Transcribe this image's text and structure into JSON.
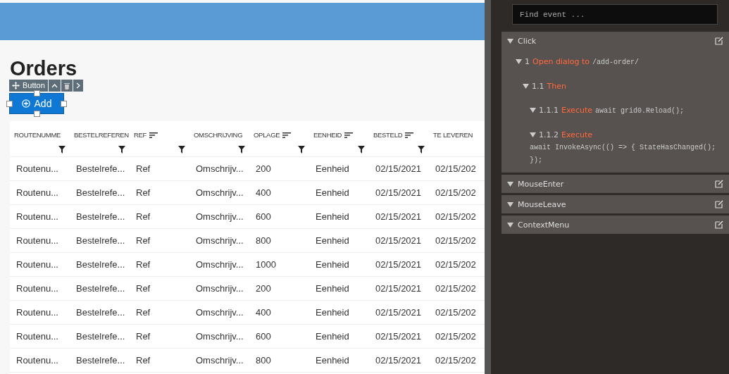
{
  "page": {
    "title": "Orders"
  },
  "designer_toolbar": {
    "label": "Button"
  },
  "add_button": {
    "label": "Add"
  },
  "grid": {
    "columns": [
      {
        "label": "ROUTENUMME",
        "sortable": false
      },
      {
        "label": "BESTELREFEREN",
        "sortable": false
      },
      {
        "label": "REF",
        "sortable": true
      },
      {
        "label": "OMSCHRIJVING",
        "sortable": false
      },
      {
        "label": "OPLAGE",
        "sortable": true
      },
      {
        "label": "EENHEID",
        "sortable": true
      },
      {
        "label": "BESTELD",
        "sortable": true
      },
      {
        "label": "TE LEVEREN",
        "sortable": false
      }
    ],
    "rows": [
      [
        "Routenu...",
        "Bestelrefe...",
        "Ref",
        "Omschrijv...",
        "200",
        "Eenheid",
        "02/15/2021",
        "02/15/202"
      ],
      [
        "Routenu...",
        "Bestelrefe...",
        "Ref",
        "Omschrijv...",
        "400",
        "Eenheid",
        "02/15/2021",
        "02/15/202"
      ],
      [
        "Routenu...",
        "Bestelrefe...",
        "Ref",
        "Omschrijv...",
        "600",
        "Eenheid",
        "02/15/2021",
        "02/15/202"
      ],
      [
        "Routenu...",
        "Bestelrefe...",
        "Ref",
        "Omschrijv...",
        "800",
        "Eenheid",
        "02/15/2021",
        "02/15/202"
      ],
      [
        "Routenu...",
        "Bestelrefe...",
        "Ref",
        "Omschrijv...",
        "1000",
        "Eenheid",
        "02/15/2021",
        "02/15/202"
      ],
      [
        "Routenu...",
        "Bestelrefe...",
        "Ref",
        "Omschrijv...",
        "200",
        "Eenheid",
        "02/15/2021",
        "02/15/202"
      ],
      [
        "Routenu...",
        "Bestelrefe...",
        "Ref",
        "Omschrijv...",
        "400",
        "Eenheid",
        "02/15/2021",
        "02/15/202"
      ],
      [
        "Routenu...",
        "Bestelrefe...",
        "Ref",
        "Omschrijv...",
        "600",
        "Eenheid",
        "02/15/2021",
        "02/15/202"
      ],
      [
        "Routenu...",
        "Bestelrefe...",
        "Ref",
        "Omschrijv...",
        "800",
        "Eenheid",
        "02/15/2021",
        "02/15/202"
      ]
    ]
  },
  "events_panel": {
    "search": {
      "placeholder": "Find event ..."
    },
    "events": [
      {
        "name": "Click",
        "actions": [
          {
            "number": "1",
            "verb": "Open dialog to",
            "code": "/add-order/",
            "children": [
              {
                "number": "1.1",
                "verb": "Then",
                "children": [
                  {
                    "number": "1.1.1",
                    "verb": "Execute",
                    "code": "await grid0.Reload();"
                  },
                  {
                    "number": "1.1.2",
                    "verb": "Execute",
                    "code": "await InvokeAsync(() => { StateHasChanged(); });"
                  }
                ]
              }
            ]
          }
        ]
      },
      {
        "name": "MouseEnter"
      },
      {
        "name": "MouseLeave"
      },
      {
        "name": "ContextMenu"
      }
    ]
  }
}
